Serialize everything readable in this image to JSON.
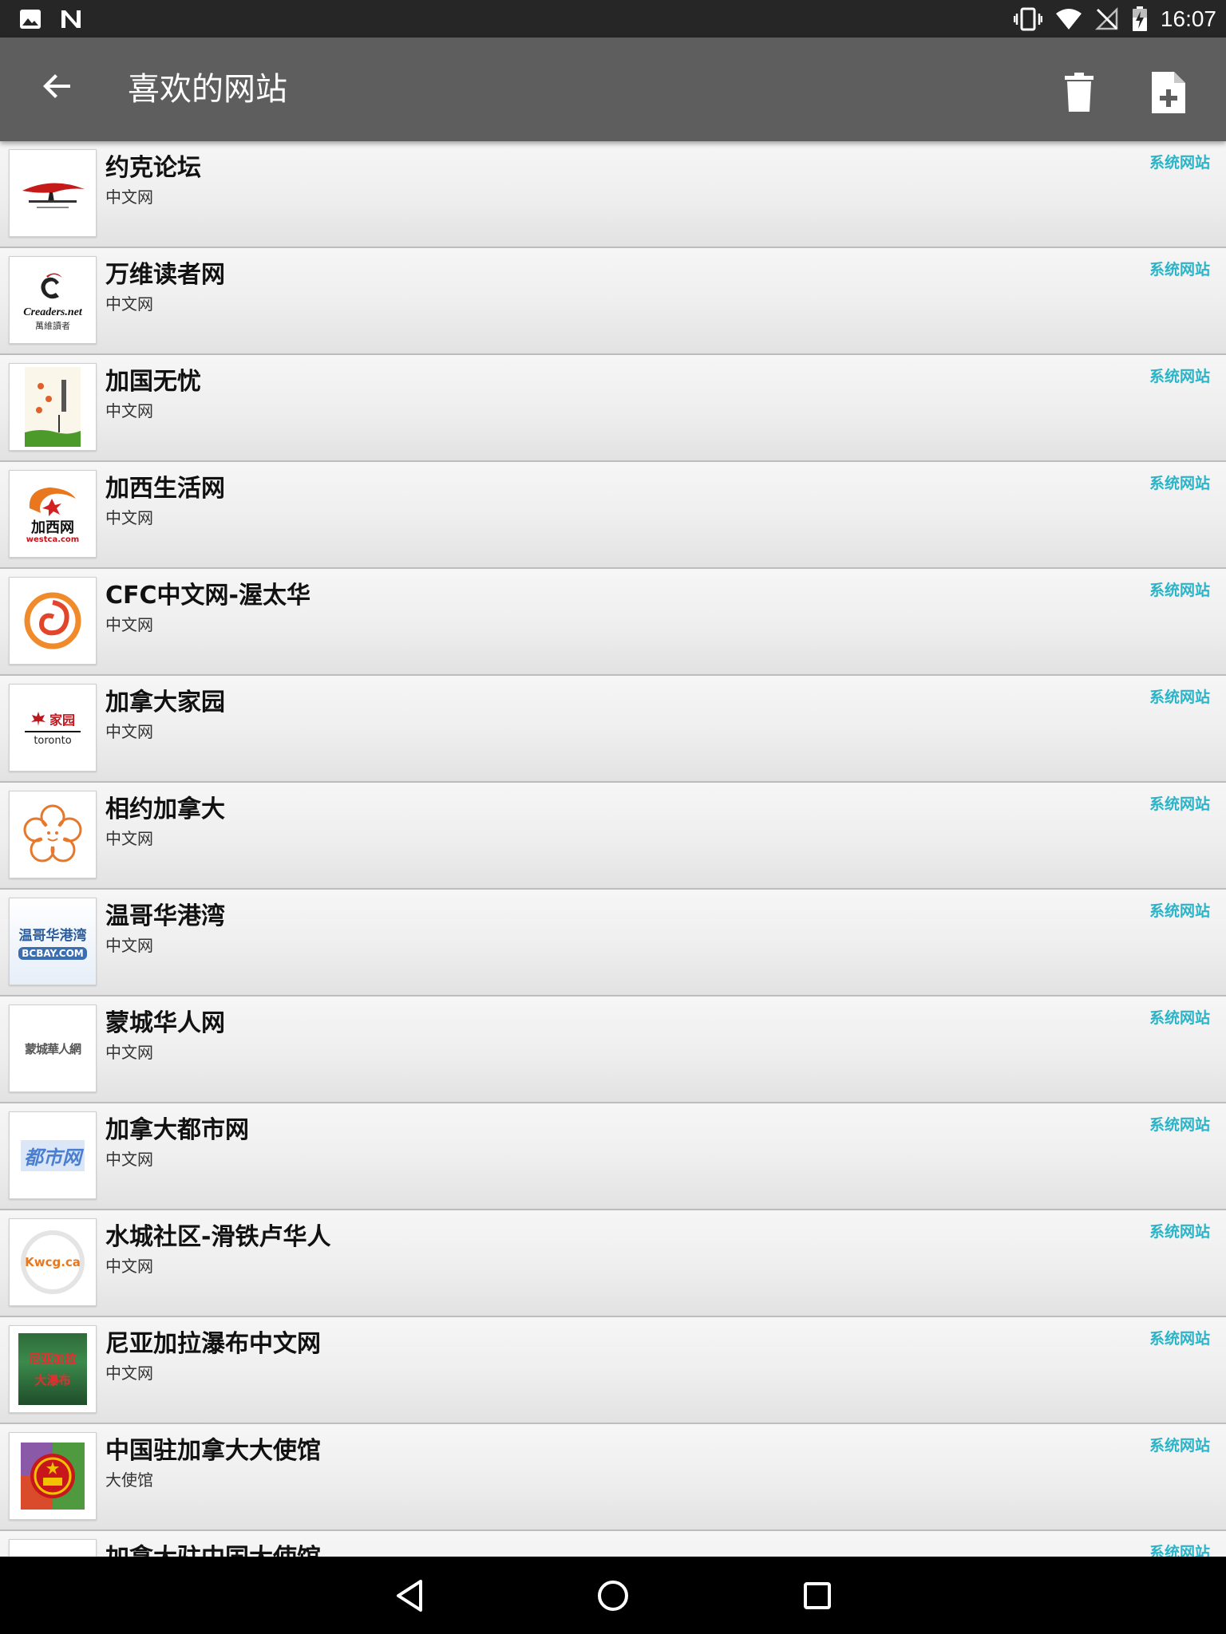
{
  "status_bar": {
    "time": "16:07",
    "left_icons": [
      "image-icon",
      "n-logo-icon"
    ],
    "right_icons": [
      "vibrate-icon",
      "wifi-icon",
      "no-sim-icon",
      "battery-charging-icon"
    ]
  },
  "app_bar": {
    "title": "喜欢的网站",
    "back_icon": "arrow-back-icon",
    "actions": [
      "trash-icon",
      "note-add-icon"
    ]
  },
  "colors": {
    "status_bar": "#262626",
    "app_bar": "#5e5e5e",
    "tag_accent": "#2bb3c7",
    "nav_bar": "#000000"
  },
  "sites": [
    {
      "title": "约克论坛",
      "subtitle": "中文网",
      "tag": "系统网站",
      "logo": "york-forum-logo"
    },
    {
      "title": "万维读者网",
      "subtitle": "中文网",
      "tag": "系统网站",
      "logo": "creaders-logo",
      "logo_text": "Creaders.net",
      "logo_subtext": "萬維讀者"
    },
    {
      "title": "加国无忧",
      "subtitle": "中文网",
      "tag": "系统网站",
      "logo": "51-logo"
    },
    {
      "title": "加西生活网",
      "subtitle": "中文网",
      "tag": "系统网站",
      "logo": "westca-logo",
      "logo_text": "加西网",
      "logo_subtext": "westca.com"
    },
    {
      "title": "CFC中文网-渥太华",
      "subtitle": "中文网",
      "tag": "系统网站",
      "logo": "cfc-swirl-logo"
    },
    {
      "title": "加拿大家园",
      "subtitle": "中文网",
      "tag": "系统网站",
      "logo": "toronto-home-logo",
      "logo_text": "家园",
      "logo_subtext": "toronto"
    },
    {
      "title": "相约加拿大",
      "subtitle": "中文网",
      "tag": "系统网站",
      "logo": "flower-logo"
    },
    {
      "title": "温哥华港湾",
      "subtitle": "中文网",
      "tag": "系统网站",
      "logo": "bcbay-logo",
      "logo_text": "温哥华港湾",
      "logo_subtext": "BCBAY.COM"
    },
    {
      "title": "蒙城华人网",
      "subtitle": "中文网",
      "tag": "系统网站",
      "logo": "montreal-chinese-logo",
      "logo_text": "蒙城華人網"
    },
    {
      "title": "加拿大都市网",
      "subtitle": "中文网",
      "tag": "系统网站",
      "logo": "dushi-logo",
      "logo_text": "都市网"
    },
    {
      "title": "水城社区-滑铁卢华人",
      "subtitle": "中文网",
      "tag": "系统网站",
      "logo": "kwcg-logo",
      "logo_text": "Kwcg.ca"
    },
    {
      "title": "尼亚加拉瀑布中文网",
      "subtitle": "中文网",
      "tag": "系统网站",
      "logo": "niagara-logo",
      "logo_text": "尼亚加拉",
      "logo_subtext": "大瀑布"
    },
    {
      "title": "中国驻加拿大大使馆",
      "subtitle": "大使馆",
      "tag": "系统网站",
      "logo": "china-emblem-logo"
    },
    {
      "title": "加拿大驻中国大使馆",
      "subtitle": "",
      "tag": "系统网站",
      "logo": "partial-logo"
    }
  ],
  "nav_bar": {
    "buttons": [
      "nav-back-icon",
      "nav-home-icon",
      "nav-recents-icon"
    ]
  }
}
